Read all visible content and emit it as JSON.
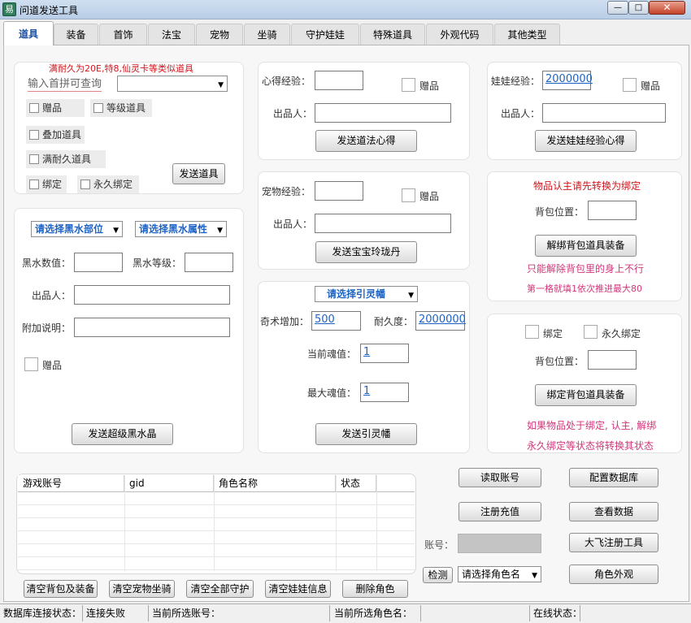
{
  "window": {
    "title": "问道发送工具",
    "icon_text": "易",
    "minimize": "—",
    "maximize": "□",
    "close": "✕"
  },
  "tabs": [
    "道具",
    "装备",
    "首饰",
    "法宝",
    "宠物",
    "坐骑",
    "守护娃娃",
    "特殊道具",
    "外观代码",
    "其他类型"
  ],
  "item_panel": {
    "note": "满耐久为20E,特8,仙灵卡等类似道具",
    "search_placeholder": "输入首拼可查询",
    "checkboxes": [
      "赠品",
      "等级道具",
      "叠加道具",
      "满耐久道具",
      "绑定",
      "永久绑定"
    ],
    "send_button": "发送道具"
  },
  "xinde_panel": {
    "exp_label": "心得经验：",
    "gift_label": "赠品",
    "producer_label": "出品人：",
    "send_button": "发送道法心得"
  },
  "wawa_panel": {
    "exp_label": "娃娃经验：",
    "exp_value": "2000000",
    "gift_label": "赠品",
    "producer_label": "出品人：",
    "send_button": "发送娃娃经验心得"
  },
  "pet_panel": {
    "exp_label": "宠物经验：",
    "gift_label": "赠品",
    "producer_label": "出品人：",
    "send_button": "发送宝宝玲珑丹"
  },
  "heishui_panel": {
    "part_select": "请选择黑水部位",
    "attr_select": "请选择黑水属性",
    "value_label": "黑水数值：",
    "level_label": "黑水等级：",
    "producer_label": "出品人：",
    "extra_label": "附加说明：",
    "gift_label": "赠品",
    "send_button": "发送超级黑水晶"
  },
  "yinling_panel": {
    "select": "请选择引灵幡",
    "qishu_label": "奇术增加：",
    "qishu_value": "500",
    "durability_label": "耐久度：",
    "durability_value": "2000000",
    "cur_soul_label": "当前魂值：",
    "cur_soul_value": "1",
    "max_soul_label": "最大魂值：",
    "max_soul_value": "1",
    "send_button": "发送引灵幡"
  },
  "unbind_panel": {
    "title": "物品认主请先转换为绑定",
    "slot_label": "背包位置：",
    "button": "解绑背包道具装备",
    "hint1": "只能解除背包里的身上不行",
    "hint2": "第一格就填1依次推进最大80"
  },
  "bind_panel": {
    "bind_label": "绑定",
    "perm_bind_label": "永久绑定",
    "slot_label": "背包位置：",
    "button": "绑定背包道具装备",
    "hint1": "如果物品处于绑定, 认主, 解绑",
    "hint2": "永久绑定等状态将转换其状态"
  },
  "account_table": {
    "columns": [
      "游戏账号",
      "gid",
      "角色名称",
      "状态"
    ]
  },
  "bottom_buttons": [
    "清空背包及装备",
    "清空宠物坐骑",
    "清空全部守护",
    "清空娃娃信息",
    "删除角色"
  ],
  "right_actions": {
    "read_account": "读取账号",
    "config_db": "配置数据库",
    "register_recharge": "注册充值",
    "view_data": "查看数据",
    "account_label": "账号：",
    "dafei_tool": "大飞注册工具",
    "detect": "检测",
    "role_select": "请选择角色名",
    "role_appearance": "角色外观"
  },
  "status": {
    "db_label": "数据库连接状态：",
    "db_value": "连接失败",
    "account_label": "当前所选账号：",
    "role_label": "当前所选角色名：",
    "online_label": "在线状态："
  }
}
